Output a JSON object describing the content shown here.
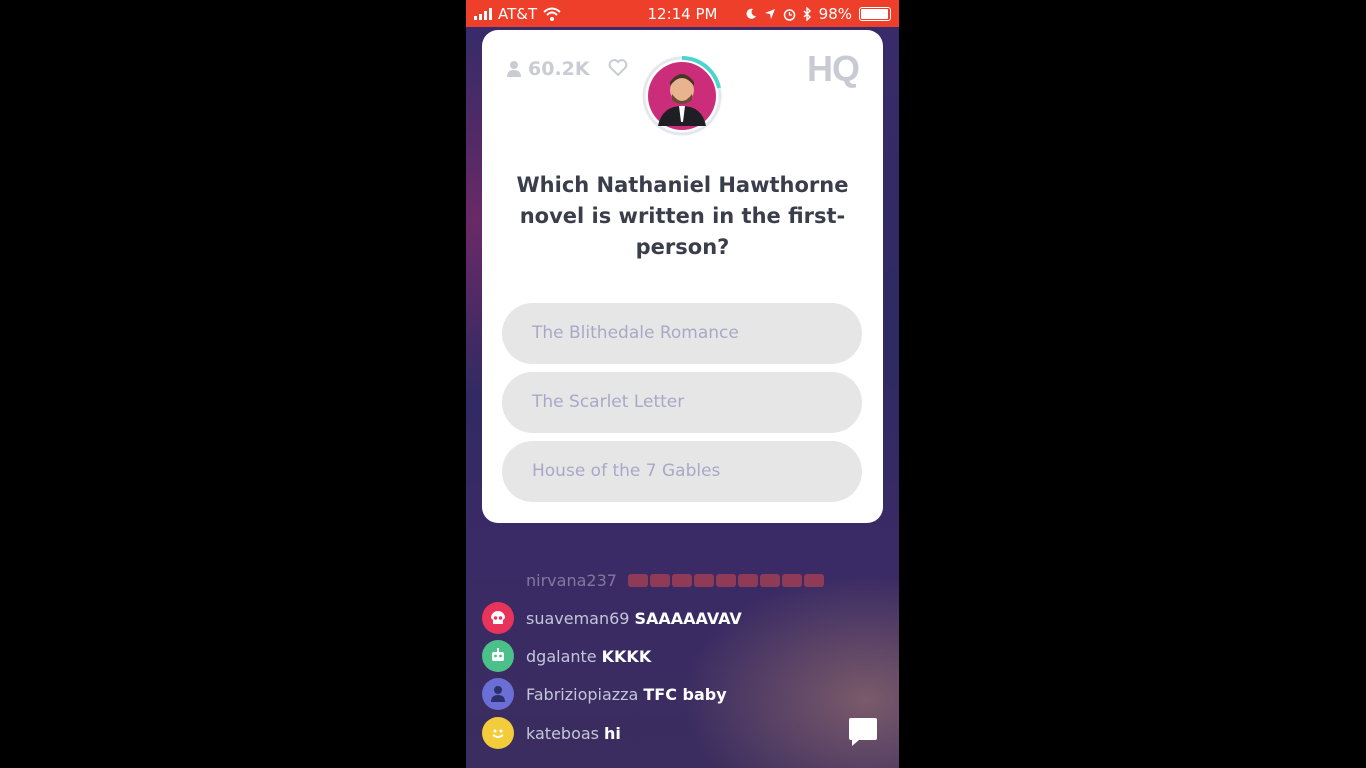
{
  "status_bar": {
    "carrier": "AT&T",
    "time": "12:14 PM",
    "battery": "98%",
    "battery_level": 0.98
  },
  "game": {
    "player_count": "60.2K",
    "logo": "HQ",
    "question": "Which Nathaniel Hawthorne novel is written in the first-person?",
    "answers": [
      {
        "label": "The Blithedale Romance"
      },
      {
        "label": "The Scarlet Letter"
      },
      {
        "label": "House of the 7 Gables"
      }
    ]
  },
  "chat": {
    "messages": [
      {
        "user": "nirvana237",
        "text": "",
        "avatar_color": "",
        "avatar_icon": ""
      },
      {
        "user": "suaveman69",
        "text": "SAAAAAVAV",
        "avatar_color": "#e8335a",
        "avatar_icon": "skull-icon"
      },
      {
        "user": "dgalante",
        "text": "KKKK",
        "avatar_color": "#4bc08a",
        "avatar_icon": "robot-icon"
      },
      {
        "user": "Fabriziopiazza",
        "text": "TFC baby",
        "avatar_color": "#6a6fd6",
        "avatar_icon": "person-icon"
      },
      {
        "user": "kateboas",
        "text": "hi",
        "avatar_color": "#f2cc3a",
        "avatar_icon": "smiley-icon"
      }
    ]
  },
  "colors": {
    "status_bar": "#ee3f2a",
    "answer_background": "#e6e6e6",
    "answer_text": "#a9a8c8"
  }
}
